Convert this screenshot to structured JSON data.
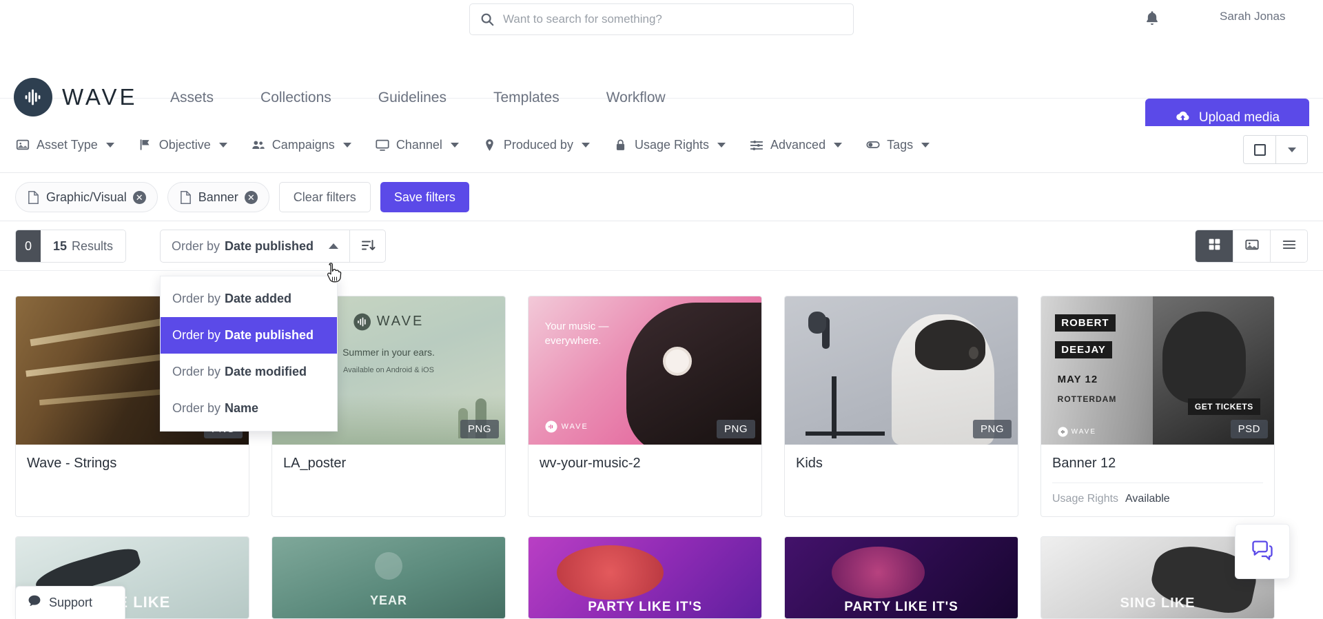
{
  "utility": {
    "search_placeholder": "Want to search for something?",
    "search_value": "",
    "user_name": "Sarah Jonas",
    "notifications_icon": "bell-icon",
    "search_icon": "search-icon"
  },
  "brand": {
    "name": "WAVE",
    "logo_icon": "wave-logo-icon"
  },
  "nav": {
    "links": [
      {
        "label": "Assets"
      },
      {
        "label": "Collections"
      },
      {
        "label": "Guidelines"
      },
      {
        "label": "Templates"
      },
      {
        "label": "Workflow"
      }
    ],
    "upload_label": "Upload media",
    "upload_icon": "cloud-upload-icon"
  },
  "filters": {
    "items": [
      {
        "label": "Asset Type",
        "icon": "image-icon"
      },
      {
        "label": "Objective",
        "icon": "flag-icon"
      },
      {
        "label": "Campaigns",
        "icon": "users-icon"
      },
      {
        "label": "Channel",
        "icon": "monitor-icon"
      },
      {
        "label": "Produced by",
        "icon": "location-pin-icon"
      },
      {
        "label": "Usage Rights",
        "icon": "lock-icon"
      },
      {
        "label": "Advanced",
        "icon": "sliders-icon"
      },
      {
        "label": "Tags",
        "icon": "toggle-icon"
      }
    ]
  },
  "chips": {
    "active": [
      {
        "label": "Graphic/Visual",
        "icon": "file-document-icon",
        "remove_icon": "close-circle-icon"
      },
      {
        "label": "Banner",
        "icon": "file-document-icon",
        "remove_icon": "close-circle-icon"
      }
    ],
    "clear_label": "Clear filters",
    "save_label": "Save filters"
  },
  "results": {
    "selected_count": "0",
    "total_count": "15",
    "results_word": "Results",
    "order_prefix": "Order by",
    "order_value": "Date published",
    "sort_direction_icon": "sort-descending-icon",
    "view_modes": [
      {
        "name": "grid-view",
        "icon": "grid-icon",
        "active": true
      },
      {
        "name": "gallery-view",
        "icon": "image-icon",
        "active": false
      },
      {
        "name": "list-view",
        "icon": "list-icon",
        "active": false
      }
    ]
  },
  "order_menu": {
    "open": true,
    "items": [
      {
        "prefix": "Order by",
        "value": "Date added",
        "selected": false
      },
      {
        "prefix": "Order by",
        "value": "Date published",
        "selected": true
      },
      {
        "prefix": "Order by",
        "value": "Date modified",
        "selected": false
      },
      {
        "prefix": "Order by",
        "value": "Name",
        "selected": false
      }
    ]
  },
  "assets": {
    "row1": [
      {
        "title": "Wave - Strings",
        "format": "PNG",
        "art": "guitar-strings-photo",
        "has_meta": false
      },
      {
        "title": "LA_poster",
        "format": "PNG",
        "art": "wave-summer-poster",
        "poster_heading": "Summer in your ears.",
        "poster_sub": "Available on Android & iOS",
        "poster_brand": "WAVE",
        "has_meta": false
      },
      {
        "title": "wv-your-music-2",
        "format": "PNG",
        "art": "headphones-pink-banner",
        "banner_line1": "Your music —",
        "banner_line2": "everywhere.",
        "banner_brand": "WAVE",
        "has_meta": false
      },
      {
        "title": "Kids",
        "format": "PNG",
        "art": "kid-microphone-photo",
        "has_meta": false
      },
      {
        "title": "Banner 12",
        "format": "PSD",
        "art": "robert-deejay-banner",
        "banner_name1": "ROBERT",
        "banner_name2": "DEEJAY",
        "banner_date": "MAY 12",
        "banner_city": "ROTTERDAM",
        "banner_cta": "GET TICKETS",
        "banner_brand": "WAVE",
        "has_meta": true,
        "meta_key": "Usage Rights",
        "meta_value": "Available"
      }
    ],
    "row2": [
      {
        "art": "dance-like-photo",
        "caption": "NCE LIKE"
      },
      {
        "art": "green-hands-poster",
        "caption": "YEAR"
      },
      {
        "art": "party-purple-1",
        "caption": "PARTY LIKE IT'S"
      },
      {
        "art": "party-purple-2",
        "caption": "PARTY LIKE IT'S"
      },
      {
        "art": "sing-like-photo",
        "caption": "SING LIKE"
      }
    ]
  },
  "widgets": {
    "support_label": "Support",
    "support_icon": "chat-bubble-icon",
    "chat_icon": "chat-support-icon"
  },
  "colors": {
    "accent": "#5b4ae8",
    "dark": "#2e3f50",
    "text": "#3c4450",
    "muted": "#6b7280"
  }
}
